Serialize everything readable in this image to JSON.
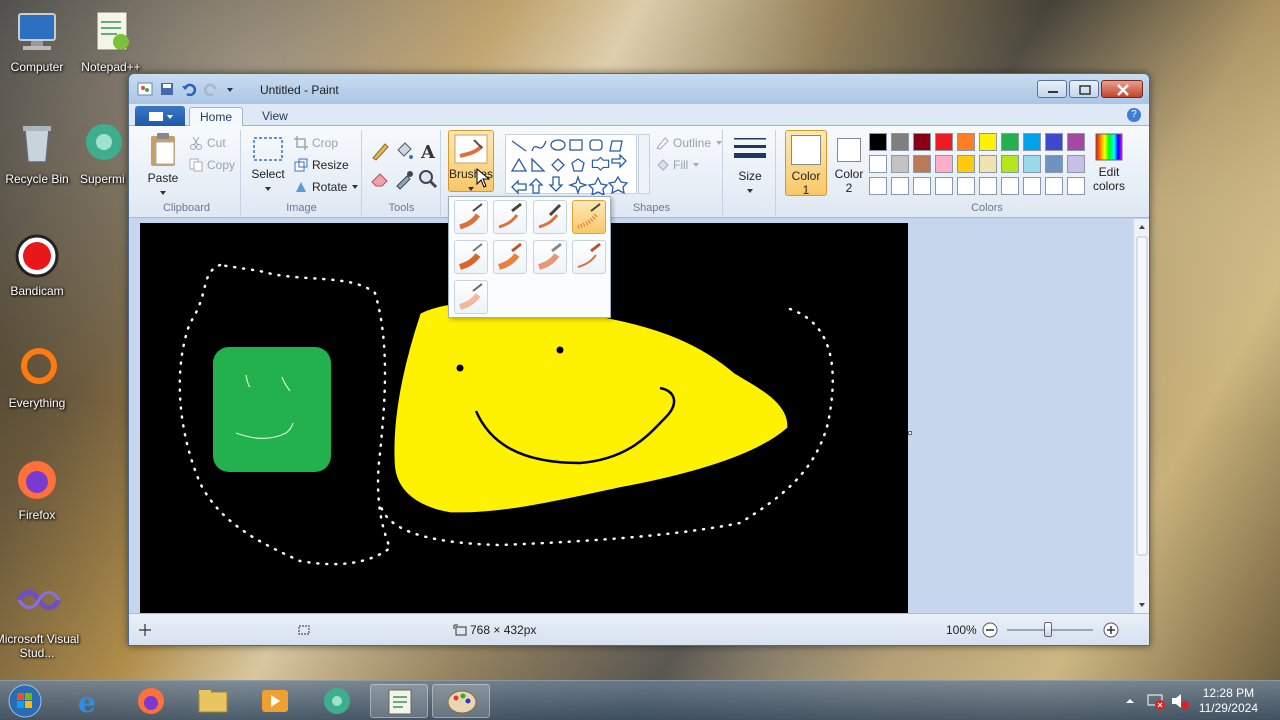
{
  "desktop": {
    "icons": [
      {
        "label": "Computer"
      },
      {
        "label": "Notepad++"
      },
      {
        "label": "Recycle Bin"
      },
      {
        "label": "Supermi"
      },
      {
        "label": "Bandicam"
      },
      {
        "label": "Everything"
      },
      {
        "label": "Firefox"
      },
      {
        "label": "Microsoft Visual Stud..."
      }
    ]
  },
  "window": {
    "title": "Untitled - Paint",
    "tabs": [
      {
        "label": "Home"
      },
      {
        "label": "View"
      }
    ],
    "ribbon": {
      "clipboard": {
        "label": "Clipboard",
        "paste": "Paste",
        "cut": "Cut",
        "copy": "Copy"
      },
      "image": {
        "label": "Image",
        "select": "Select",
        "crop": "Crop",
        "resize": "Resize",
        "rotate": "Rotate"
      },
      "tools": {
        "label": "Tools"
      },
      "brushes": {
        "label": "Brushes"
      },
      "shapes": {
        "label": "Shapes",
        "outline": "Outline",
        "fill": "Fill"
      },
      "size": {
        "label": "Size"
      },
      "colors": {
        "label": "Colors",
        "color1": "Color",
        "color1_num": "1",
        "color2": "Color",
        "color2_num": "2",
        "edit": "Edit",
        "edit2": "colors"
      }
    },
    "palette": [
      "#000000",
      "#7f7f7f",
      "#880015",
      "#ed1c24",
      "#ff7f27",
      "#fff200",
      "#22b14c",
      "#00a2e8",
      "#3f48cc",
      "#a349a4",
      "#ffffff",
      "#c3c3c3",
      "#b97a57",
      "#ffaec9",
      "#ffc90e",
      "#efe4b0",
      "#b5e61d",
      "#99d9ea",
      "#7092be",
      "#c8bfe7",
      "#ffffff",
      "#ffffff",
      "#ffffff",
      "#ffffff",
      "#ffffff",
      "#ffffff",
      "#ffffff",
      "#ffffff",
      "#ffffff",
      "#ffffff"
    ],
    "status": {
      "dimensions": "768 × 432px",
      "zoom": "100%"
    }
  },
  "taskbar": {
    "time": "12:28 PM",
    "date": "11/29/2024"
  },
  "colors": {
    "canvas": "#000000",
    "face": "#fff200",
    "square": "#22b14c",
    "accent": "#f8c868"
  }
}
